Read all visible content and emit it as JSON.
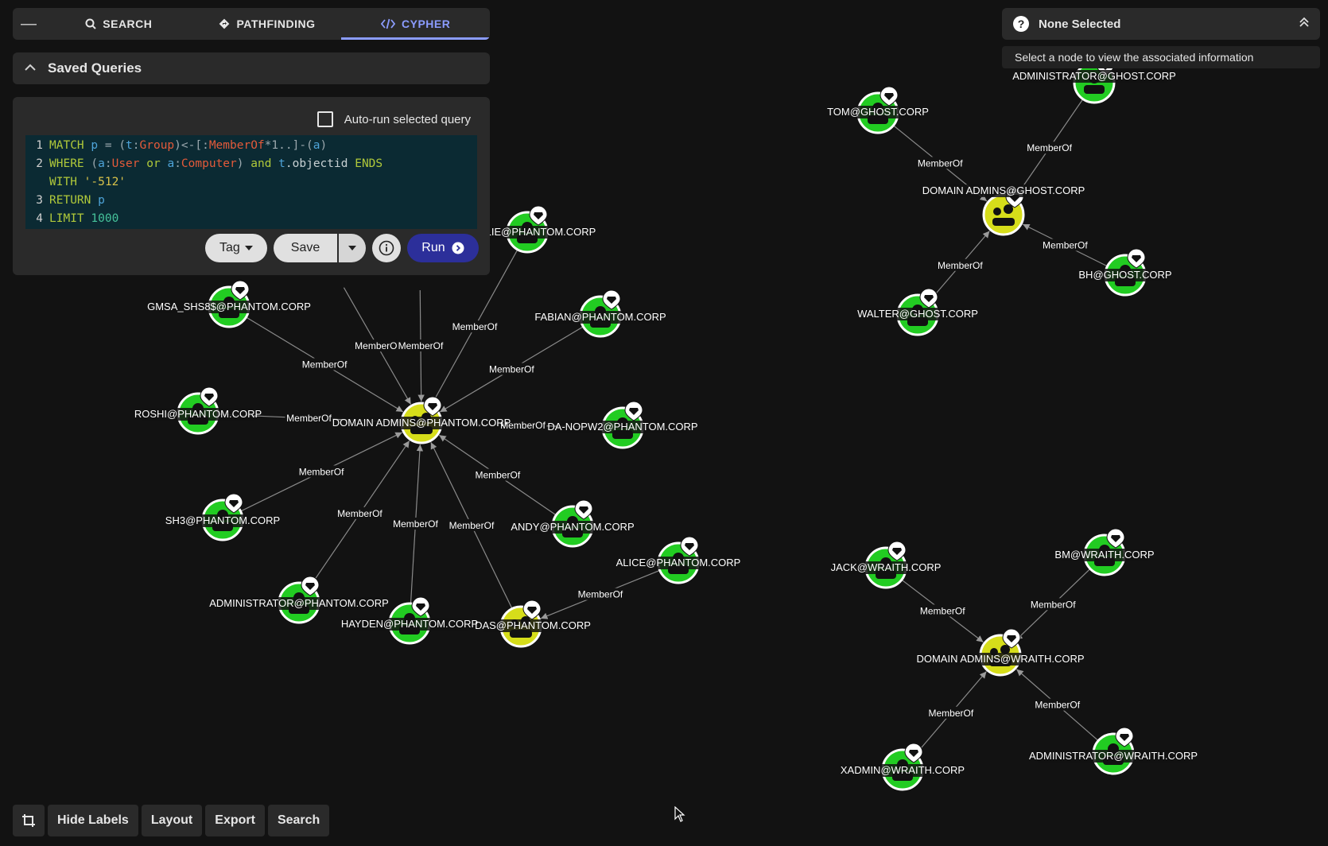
{
  "tabs": {
    "collapse_glyph": "—",
    "search": "SEARCH",
    "pathfinding": "PATHFINDING",
    "cypher": "CYPHER"
  },
  "saved_queries": {
    "title": "Saved Queries"
  },
  "query": {
    "autorun_label": "Auto-run selected query",
    "line_numbers": [
      "1",
      "2",
      "",
      "3",
      "4"
    ],
    "buttons": {
      "tag": "Tag",
      "save": "Save",
      "run": "Run"
    }
  },
  "selection": {
    "title": "None Selected",
    "hint": "Select a node to view the associated information"
  },
  "toolbar": {
    "hide_labels": "Hide Labels",
    "layout": "Layout",
    "export": "Export",
    "search": "Search"
  },
  "graph": {
    "edge_label": "MemberOf",
    "colors": {
      "user": "#22cc22",
      "group": "#d6dd1a",
      "edge": "#8a8a8a"
    },
    "nodes": [
      {
        "id": "da_phantom",
        "label": "DOMAIN ADMINS@PHANTOM.CORP",
        "kind": "group"
      },
      {
        "id": "lie",
        "label": "LIE@PHANTOM.CORP",
        "kind": "user"
      },
      {
        "id": "gmsa",
        "label": "GMSA_SHS8$@PHANTOM.CORP",
        "kind": "user"
      },
      {
        "id": "fabian",
        "label": "FABIAN@PHANTOM.CORP",
        "kind": "user"
      },
      {
        "id": "roshi",
        "label": "ROSHI@PHANTOM.CORP",
        "kind": "user"
      },
      {
        "id": "danopw2",
        "label": "DA-NOPW2@PHANTOM.CORP",
        "kind": "user"
      },
      {
        "id": "sh3",
        "label": "SH3@PHANTOM.CORP",
        "kind": "user"
      },
      {
        "id": "andy",
        "label": "ANDY@PHANTOM.CORP",
        "kind": "user"
      },
      {
        "id": "alice",
        "label": "ALICE@PHANTOM.CORP",
        "kind": "user"
      },
      {
        "id": "admin_phantom",
        "label": "ADMINISTRATOR@PHANTOM.CORP",
        "kind": "user"
      },
      {
        "id": "hayden",
        "label": "HAYDEN@PHANTOM.CORP",
        "kind": "user"
      },
      {
        "id": "das",
        "label": "DAS@PHANTOM.CORP",
        "kind": "group"
      },
      {
        "id": "da_ghost",
        "label": "DOMAIN ADMINS@GHOST.CORP",
        "kind": "group"
      },
      {
        "id": "admin_ghost",
        "label": "ADMINISTRATOR@GHOST.CORP",
        "kind": "user"
      },
      {
        "id": "tom",
        "label": "TOM@GHOST.CORP",
        "kind": "user"
      },
      {
        "id": "bh",
        "label": "BH@GHOST.CORP",
        "kind": "user"
      },
      {
        "id": "walter",
        "label": "WALTER@GHOST.CORP",
        "kind": "user"
      },
      {
        "id": "da_wraith",
        "label": "DOMAIN ADMINS@WRAITH.CORP",
        "kind": "group"
      },
      {
        "id": "jack",
        "label": "JACK@WRAITH.CORP",
        "kind": "user"
      },
      {
        "id": "bm",
        "label": "BM@WRAITH.CORP",
        "kind": "user"
      },
      {
        "id": "xadmin",
        "label": "XADMIN@WRAITH.CORP",
        "kind": "user"
      },
      {
        "id": "admin_wraith",
        "label": "ADMINISTRATOR@WRAITH.CORP",
        "kind": "user"
      },
      {
        "id": "hidden1",
        "label": "",
        "kind": "user"
      },
      {
        "id": "hidden2",
        "label": "",
        "kind": "user"
      }
    ],
    "edges": [
      [
        "hidden1",
        "da_phantom"
      ],
      [
        "hidden2",
        "da_phantom"
      ],
      [
        "lie",
        "da_phantom"
      ],
      [
        "gmsa",
        "da_phantom"
      ],
      [
        "fabian",
        "da_phantom"
      ],
      [
        "roshi",
        "da_phantom"
      ],
      [
        "danopw2",
        "da_phantom"
      ],
      [
        "sh3",
        "da_phantom"
      ],
      [
        "andy",
        "da_phantom"
      ],
      [
        "admin_phantom",
        "da_phantom"
      ],
      [
        "hayden",
        "da_phantom"
      ],
      [
        "das",
        "da_phantom"
      ],
      [
        "alice",
        "das"
      ],
      [
        "tom",
        "da_ghost"
      ],
      [
        "admin_ghost",
        "da_ghost"
      ],
      [
        "bh",
        "da_ghost"
      ],
      [
        "walter",
        "da_ghost"
      ],
      [
        "jack",
        "da_wraith"
      ],
      [
        "bm",
        "da_wraith"
      ],
      [
        "xadmin",
        "da_wraith"
      ],
      [
        "admin_wraith",
        "da_wraith"
      ]
    ]
  }
}
